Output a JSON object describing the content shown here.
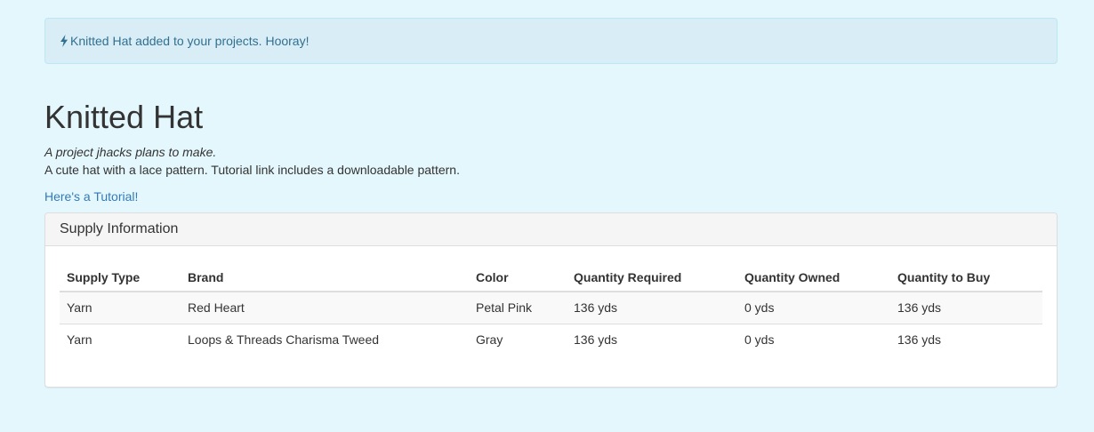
{
  "alert": {
    "message": "Knitted Hat added to your projects. Hooray!"
  },
  "project": {
    "title": "Knitted Hat",
    "subtitle": "A project jhacks plans to make.",
    "description": "A cute hat with a lace pattern. Tutorial link includes a downloadable pattern.",
    "tutorial_link": "Here's a Tutorial!"
  },
  "supply_panel": {
    "heading": "Supply Information",
    "columns": [
      "Supply Type",
      "Brand",
      "Color",
      "Quantity Required",
      "Quantity Owned",
      "Quantity to Buy"
    ],
    "rows": [
      [
        "Yarn",
        "Red Heart",
        "Petal Pink",
        "136 yds",
        "0 yds",
        "136 yds"
      ],
      [
        "Yarn",
        "Loops & Threads Charisma Tweed",
        "Gray",
        "136 yds",
        "0 yds",
        "136 yds"
      ]
    ]
  },
  "colors": {
    "page_background": "#e4f7fd",
    "alert_background": "#d9edf7",
    "alert_text": "#31708f",
    "link": "#337ab7"
  },
  "icons": {
    "alert_icon": "flash-icon"
  }
}
